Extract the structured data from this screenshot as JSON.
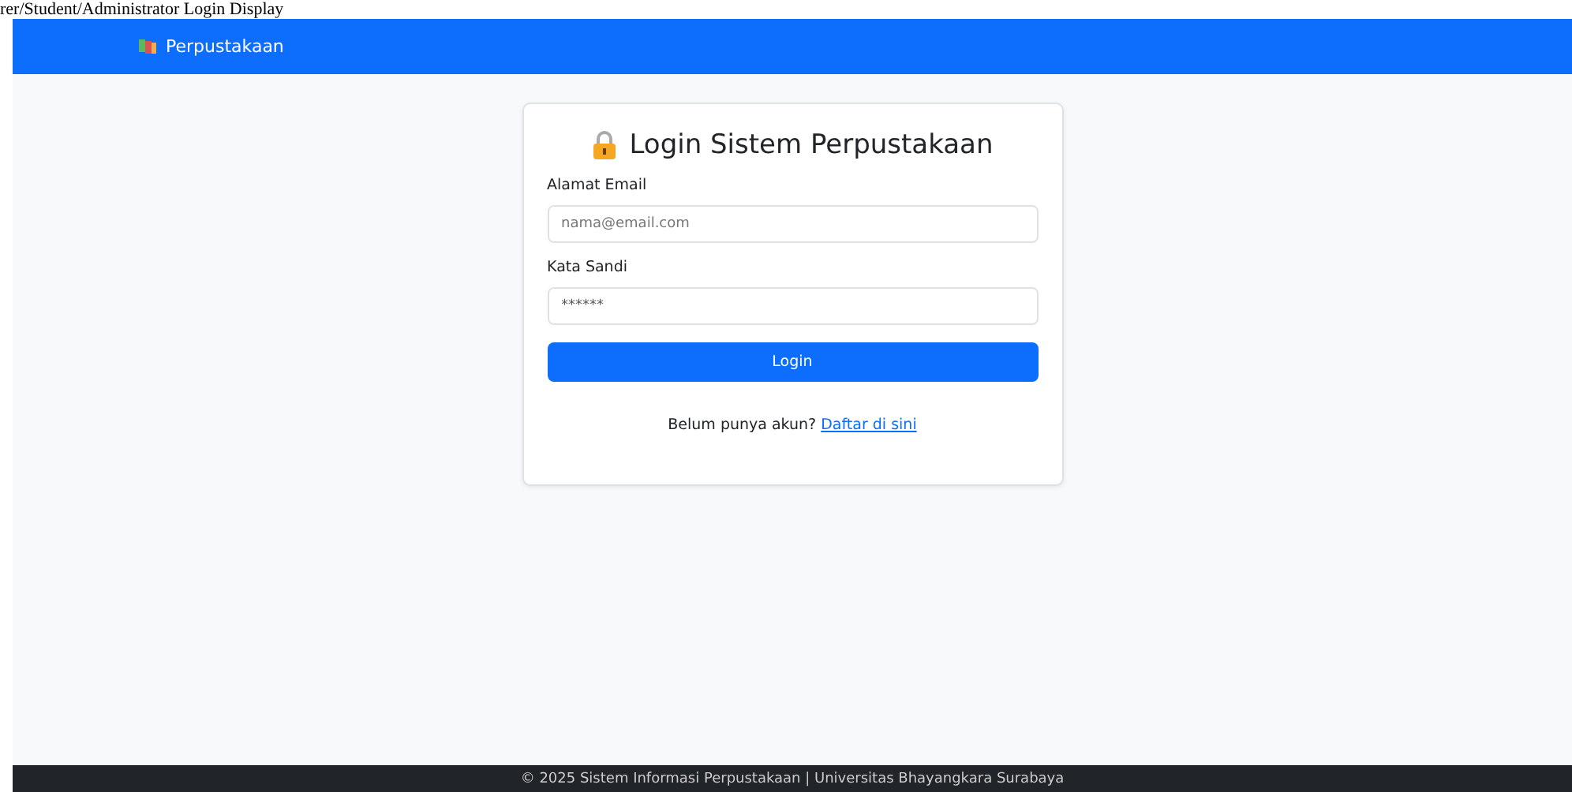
{
  "caption": "rer/Student/Administrator Login Display",
  "navbar": {
    "brand": "Perpustakaan"
  },
  "login_card": {
    "title": "Login Sistem Perpustakaan",
    "fields": [
      {
        "label": "Alamat Email",
        "placeholder": "nama@email.com"
      },
      {
        "label": "Kata Sandi",
        "value": "******"
      }
    ],
    "submit": "Login",
    "register_prompt": "Belum punya akun?",
    "register_link": "Daftar di sini"
  },
  "footer": "© 2025 Sistem Informasi Perpustakaan | Universitas Bhayangkara Surabaya"
}
